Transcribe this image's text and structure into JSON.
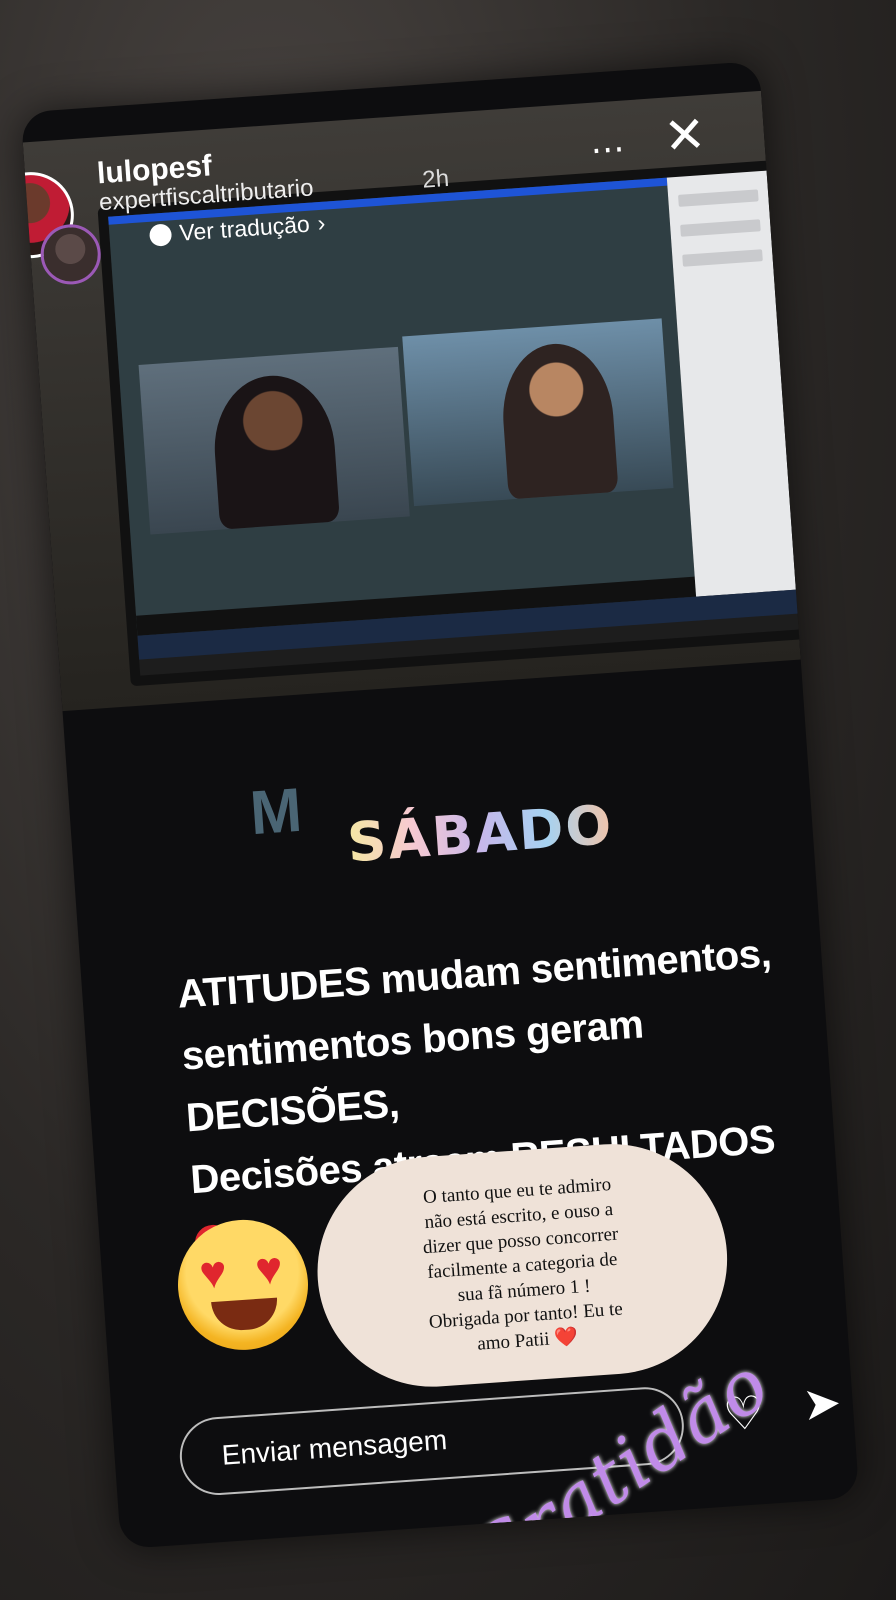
{
  "story": {
    "username": "lulopesf",
    "subname": "expertfiscaltributario",
    "time": "2h",
    "translate_label": "Ver tradução",
    "more_icon": "⋯",
    "close_icon": "✕"
  },
  "content": {
    "logo_letter": "M",
    "day": "SÁBADO",
    "quote_line1": "ATITUDES mudam sentimentos,",
    "quote_line2": "sentimentos bons geram DECISÕES,",
    "quote_line3": "Decisões atraem RESULTADOS",
    "bubble_text": "O tanto que eu te admiro\nnão está escrito, e ouso a\ndizer que posso concorrer\nfacilmente a categoria de\nsua fã número 1 !\nObrigada por tanto! Eu te\namo Patii ❤️",
    "sticker": "Gratidão"
  },
  "footer": {
    "message_placeholder": "Enviar mensagem",
    "heart_icon": "♡",
    "send_icon": "➤"
  }
}
